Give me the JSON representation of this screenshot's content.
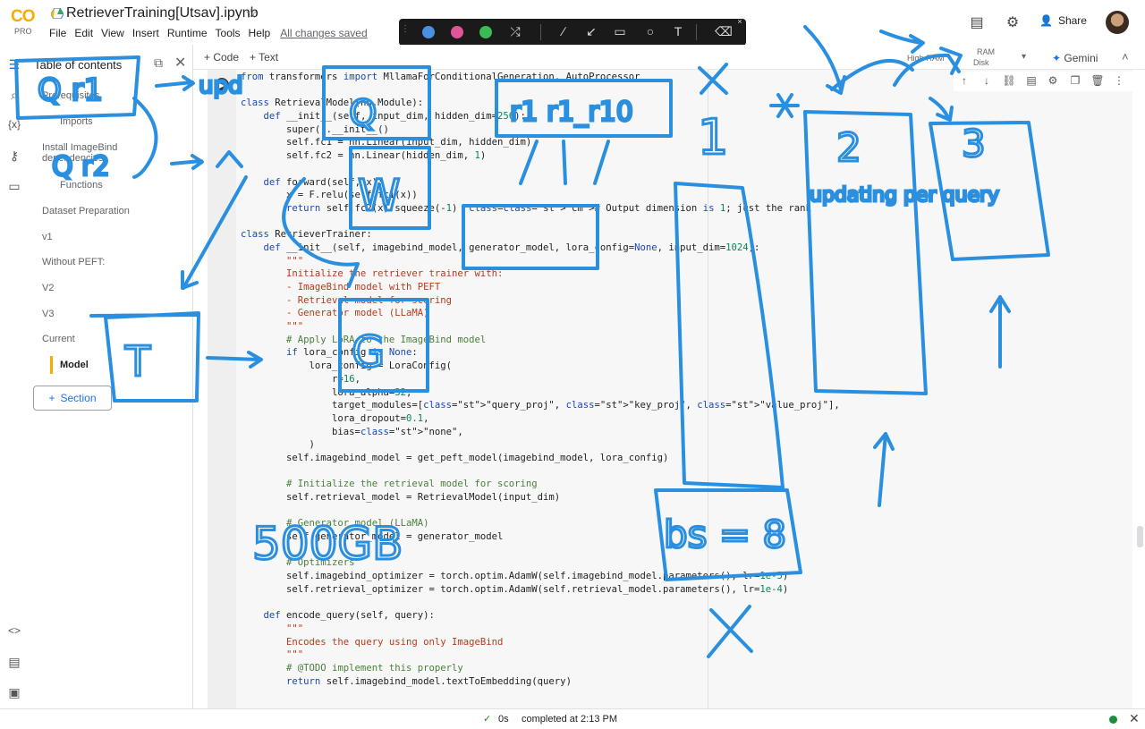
{
  "app": {
    "logo_text": "CO",
    "plan": "PRO",
    "notebook_title": "RetrieverTraining[Utsav].ipynb",
    "menu": [
      "File",
      "Edit",
      "View",
      "Insert",
      "Runtime",
      "Tools",
      "Help"
    ],
    "save_status": "All changes saved",
    "share_label": "Share"
  },
  "toolbar": {
    "add_code": "+ Code",
    "add_text": "+ Text",
    "ram_label": "RAM",
    "disk_label": "Disk",
    "runtime_type": "High-RAM",
    "gemini_label": "Gemini"
  },
  "pen_toolbar": {
    "colors": [
      "#4a90e2",
      "#e0559a",
      "#3cba54"
    ]
  },
  "toc": {
    "title": "Table of contents",
    "items": [
      {
        "label": "Prerequisites",
        "level": 1
      },
      {
        "label": "Imports",
        "level": 2
      },
      {
        "label": "Install ImageBind dependencies",
        "level": 1
      },
      {
        "label": "Functions",
        "level": 2
      },
      {
        "label": "Dataset Preparation",
        "level": 1
      },
      {
        "label": "v1",
        "level": 1
      },
      {
        "label": "Without PEFT:",
        "level": 1
      },
      {
        "label": "V2",
        "level": 1
      },
      {
        "label": "V3",
        "level": 1
      },
      {
        "label": "Current",
        "level": 1
      },
      {
        "label": "Model",
        "level": 2,
        "current": true
      }
    ],
    "section_button": "Section"
  },
  "code_lines": [
    "from transformers import MllamaForConditionalGeneration, AutoProcessor",
    "",
    "class RetrievalModel(nn.Module):",
    "    def __init__(self, input_dim, hidden_dim=256):",
    "        super().__init__()",
    "        self.fc1 = nn.Linear(input_dim, hidden_dim)",
    "        self.fc2 = nn.Linear(hidden_dim, 1)",
    "",
    "    def forward(self, x):",
    "        x = F.relu(self.fc1(x))",
    "        return self.fc2(x).squeeze(-1)  # Output dimension is 1; just the rank",
    "",
    "class RetrieverTrainer:",
    "    def __init__(self, imagebind_model, generator_model, lora_config=None, input_dim=1024):",
    "        \"\"\"",
    "        Initialize the retriever trainer with:",
    "        - ImageBind model with PEFT",
    "        - Retrieval model for scoring",
    "        - Generator model (LLaMA)",
    "        \"\"\"",
    "        # Apply LoRA to the ImageBind model",
    "        if lora_config is None:",
    "            lora_config = LoraConfig(",
    "                r=16,",
    "                lora_alpha=32,",
    "                target_modules=[\"query_proj\", \"key_proj\", \"value_proj\"],",
    "                lora_dropout=0.1,",
    "                bias=\"none\",",
    "            )",
    "        self.imagebind_model = get_peft_model(imagebind_model, lora_config)",
    "",
    "        # Initialize the retrieval model for scoring",
    "        self.retrieval_model = RetrievalModel(input_dim)",
    "",
    "        # Generator model (LLaMA)",
    "        self.generator_model = generator_model",
    "",
    "        # Optimizers",
    "        self.imagebind_optimizer = torch.optim.AdamW(self.imagebind_model.parameters(), lr=1e-5)",
    "        self.retrieval_optimizer = torch.optim.AdamW(self.retrieval_model.parameters(), lr=1e-4)",
    "",
    "    def encode_query(self, query):",
    "        \"\"\"",
    "        Encodes the query using only ImageBind",
    "        \"\"\"",
    "        # @TODO implement this properly",
    "        return self.imagebind_model.textToEmbedding(query)"
  ],
  "status_bar": {
    "elapsed": "0s",
    "message": "completed at 2:13 PM"
  },
  "annotations": {
    "ink_color": "#2b8fe0",
    "handwritten": [
      "Q r1",
      "upd",
      "Q r2",
      "Q",
      "W",
      "r1  r1_r10",
      "1",
      "2",
      "updating per query",
      "3",
      "T",
      "G",
      "500GB",
      "bs = 8"
    ]
  }
}
